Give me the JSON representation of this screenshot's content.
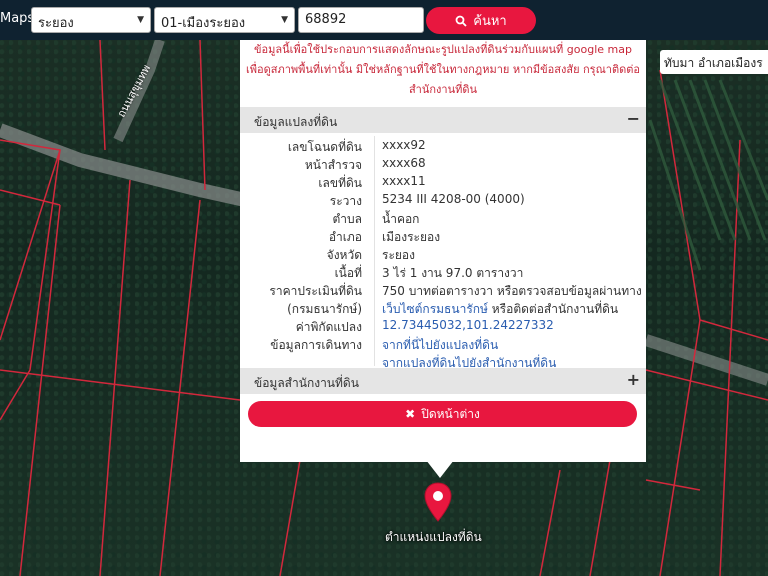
{
  "header": {
    "brand": "Maps",
    "province_select": "ระยอง",
    "district_select": "01-เมืองระยอง",
    "deed_input": "68892",
    "search_label": "ค้นหา"
  },
  "map": {
    "road_label": "ถนนสุขุมทพ",
    "top_right_label": "ทับมา อำเภอเมืองร",
    "marker_label": "ตำแหน่งแปลงที่ดิน"
  },
  "popup": {
    "notice_lines": [
      "ข้อมูลนี้เพื่อใช้ประกอบการแสดงลักษณะรูปแปลงที่ดินร่วมกับแผนที่ google map",
      "เพื่อดูสภาพพื้นที่เท่านั้น มิใช่หลักฐานที่ใช้ในทางกฎหมาย หากมีข้อสงสัย กรุณาติดต่อ",
      "สำนักงานที่ดิน"
    ],
    "section1_title": "ข้อมูลแปลงที่ดิน",
    "section1_toggle": "−",
    "rows": [
      {
        "k": "เลขโฉนดที่ดิน",
        "v": "xxxx92"
      },
      {
        "k": "หน้าสำรวจ",
        "v": "xxxx68"
      },
      {
        "k": "เลขที่ดิน",
        "v": "xxxx11"
      },
      {
        "k": "ระวาง",
        "v": "5234 III 4208-00 (4000)"
      },
      {
        "k": "ตำบล",
        "v": "น้ำคอก"
      },
      {
        "k": "อำเภอ",
        "v": "เมืองระยอง"
      },
      {
        "k": "จังหวัด",
        "v": "ระยอง"
      },
      {
        "k": "เนื้อที่",
        "v": "3 ไร่ 1 งาน 97.0 ตารางวา"
      },
      {
        "k": "ราคาประเมินที่ดิน",
        "v": "750 บาทต่อตารางวา หรือตรวจสอบข้อมูลผ่านทาง"
      },
      {
        "k": "(กรมธนารักษ์)",
        "v": "เว็บไซต์กรมธนารักษ์",
        "v2": " หรือติดต่อสำนักงานที่ดิน"
      },
      {
        "k": "ค่าพิกัดแปลง",
        "v": "12.73445032,101.24227332"
      },
      {
        "k": "ข้อมูลการเดินทาง",
        "v": "จากที่นี่ไปยังแปลงที่ดิน"
      },
      {
        "k": "",
        "v": "จากแปลงที่ดินไปยังสำนักงานที่ดิน"
      }
    ],
    "section2_title": "ข้อมูลสำนักงานที่ดิน",
    "section2_toggle": "+",
    "close_label": "ปิดหน้าต่าง"
  },
  "icons": {
    "search": "search-icon",
    "close": "close-icon",
    "marker": "map-pin-icon"
  },
  "colors": {
    "accent": "#e8173f",
    "notice": "#c8283a",
    "link": "#2a5db0",
    "header_bg": "#0f2230"
  }
}
